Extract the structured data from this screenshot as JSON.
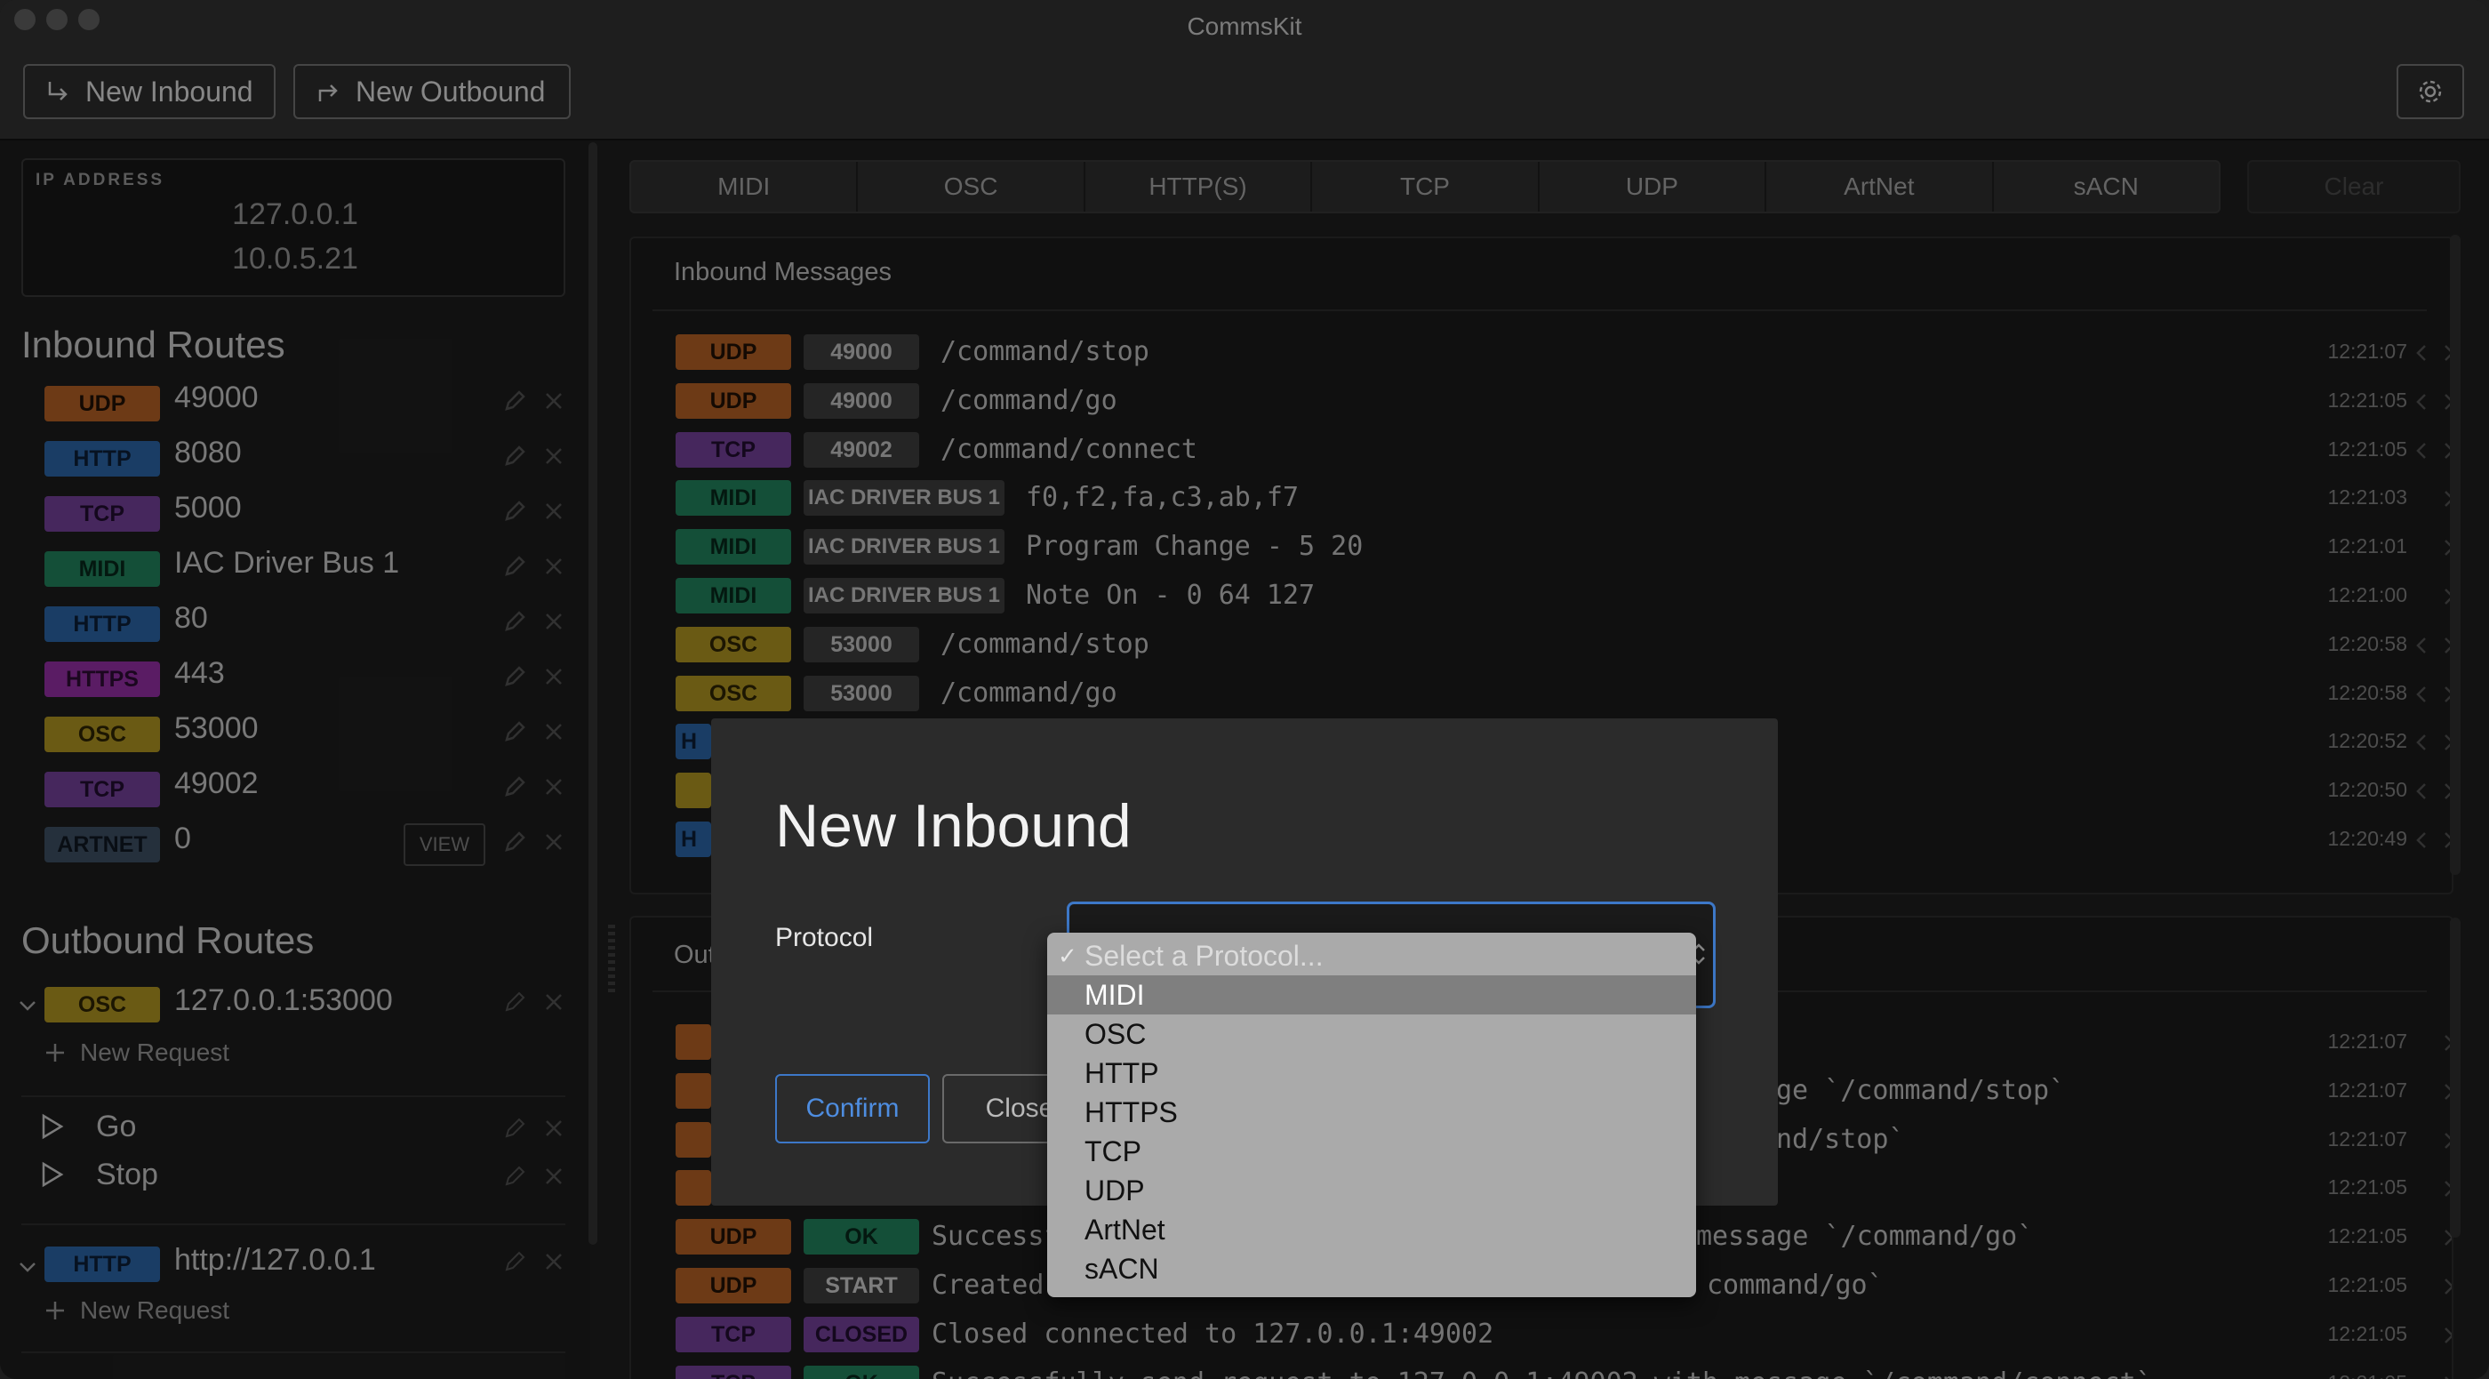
{
  "app": {
    "title": "CommsKit"
  },
  "toolbar": {
    "new_inbound": "New Inbound",
    "new_outbound": "New Outbound"
  },
  "ip": {
    "label": "IP ADDRESS",
    "addresses": [
      "127.0.0.1",
      "10.0.5.21"
    ]
  },
  "inbound_routes": {
    "title": "Inbound Routes",
    "items": [
      {
        "protocol": "UDP",
        "value": "49000"
      },
      {
        "protocol": "HTTP",
        "value": "8080"
      },
      {
        "protocol": "TCP",
        "value": "5000"
      },
      {
        "protocol": "MIDI",
        "value": "IAC Driver Bus 1"
      },
      {
        "protocol": "HTTP",
        "value": "80"
      },
      {
        "protocol": "HTTPS",
        "value": "443"
      },
      {
        "protocol": "OSC",
        "value": "53000"
      },
      {
        "protocol": "TCP",
        "value": "49002"
      },
      {
        "protocol": "ARTNET",
        "value": "0",
        "view_label": "VIEW"
      }
    ]
  },
  "outbound_routes": {
    "title": "Outbound Routes",
    "groups": [
      {
        "protocol": "OSC",
        "target": "127.0.0.1:53000",
        "new_request": "New Request",
        "actions": [
          "Go",
          "Stop"
        ]
      },
      {
        "protocol": "HTTP",
        "target": "http://127.0.0.1",
        "new_request": "New Request"
      }
    ]
  },
  "tabs": [
    "MIDI",
    "OSC",
    "HTTP(S)",
    "TCP",
    "UDP",
    "ArtNet",
    "sACN"
  ],
  "clear_label": "Clear",
  "inbound_messages": {
    "title": "Inbound Messages",
    "rows": [
      {
        "protocol": "UDP",
        "source": "49000",
        "message": "/command/stop",
        "time": "12:21:07"
      },
      {
        "protocol": "UDP",
        "source": "49000",
        "message": "/command/go",
        "time": "12:21:05"
      },
      {
        "protocol": "TCP",
        "source": "49002",
        "message": "/command/connect",
        "time": "12:21:05"
      },
      {
        "protocol": "MIDI",
        "source": "IAC DRIVER BUS 1",
        "message": "f0,f2,fa,c3,ab,f7",
        "time": "12:21:03"
      },
      {
        "protocol": "MIDI",
        "source": "IAC DRIVER BUS 1",
        "message": "Program Change - 5 20",
        "time": "12:21:01"
      },
      {
        "protocol": "MIDI",
        "source": "IAC DRIVER BUS 1",
        "message": "Note On - 0 64 127",
        "time": "12:21:00"
      },
      {
        "protocol": "OSC",
        "source": "53000",
        "message": "/command/stop",
        "time": "12:20:58"
      },
      {
        "protocol": "OSC",
        "source": "53000",
        "message": "/command/go",
        "time": "12:20:58"
      },
      {
        "protocol": "H",
        "source": "",
        "message": "",
        "time": "12:20:52"
      },
      {
        "protocol": "",
        "source": "",
        "message": "",
        "time": "12:20:50"
      },
      {
        "protocol": "H",
        "source": "",
        "message": "",
        "time": "12:20:49"
      }
    ]
  },
  "outbound_messages": {
    "title_partial": "Out",
    "rows": [
      {
        "protocol": "",
        "status": "",
        "message": "",
        "time": "12:21:07"
      },
      {
        "protocol": "",
        "status": "",
        "message": "ge `/command/stop`",
        "time": "12:21:07"
      },
      {
        "protocol": "",
        "status": "",
        "message": "nd/stop`",
        "time": "12:21:07"
      },
      {
        "protocol": "",
        "status": "",
        "message": "",
        "time": "12:21:05"
      },
      {
        "protocol": "UDP",
        "status": "OK",
        "message": "Successf",
        "message_tail": "message `/command/go`",
        "time": "12:21:05"
      },
      {
        "protocol": "UDP",
        "status": "START",
        "message": "Created",
        "message_tail": "command/go`",
        "time": "12:21:05"
      },
      {
        "protocol": "TCP",
        "status": "CLOSED",
        "message": "Closed connected to 127.0.0.1:49002",
        "time": "12:21:05"
      },
      {
        "protocol": "TCP",
        "status": "OK",
        "message": "Successfully send request to 127.0.0.1:49002 with message `/command/connect`",
        "time": "12:21:05"
      }
    ]
  },
  "modal": {
    "title": "New Inbound",
    "protocol_label": "Protocol",
    "confirm": "Confirm",
    "close": "Close",
    "dropdown": {
      "placeholder": "Select a Protocol...",
      "options": [
        "MIDI",
        "OSC",
        "HTTP",
        "HTTPS",
        "TCP",
        "UDP",
        "ArtNet",
        "sACN"
      ],
      "highlighted": "MIDI"
    }
  },
  "colors": {
    "udp": "#a85a22",
    "http": "#285e9c",
    "tcp": "#6c3c90",
    "midi": "#1f7a56",
    "https": "#8a2c9a",
    "osc": "#a48a20",
    "artnet": "#3a4a5c",
    "accent": "#3d78c8"
  }
}
